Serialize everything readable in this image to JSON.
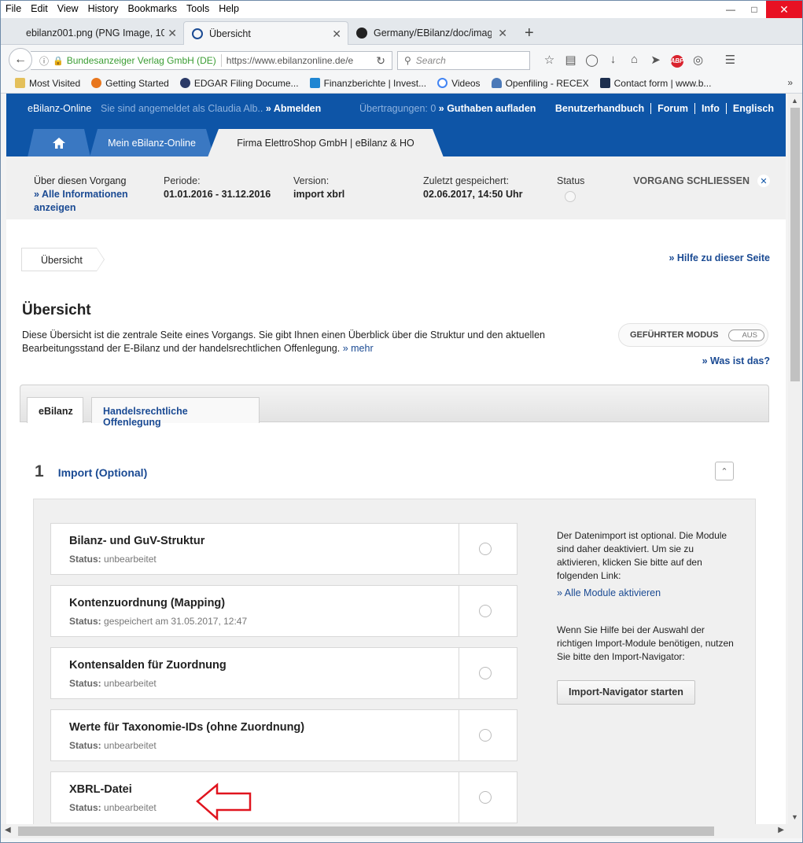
{
  "browser": {
    "menu": [
      "File",
      "Edit",
      "View",
      "History",
      "Bookmarks",
      "Tools",
      "Help"
    ],
    "tabs": [
      {
        "label": "ebilanz001.png (PNG Image, 101"
      },
      {
        "label": "Übersicht"
      },
      {
        "label": "Germany/EBilanz/doc/imag"
      }
    ],
    "url": {
      "org": "Bundesanzeiger Verlag GmbH (DE)",
      "address": "https://www.ebilanzonline.de/e"
    },
    "search_placeholder": "Search",
    "bookmarks": [
      {
        "label": "Most Visited"
      },
      {
        "label": "Getting Started"
      },
      {
        "label": "EDGAR Filing Docume..."
      },
      {
        "label": "Finanzberichte | Invest..."
      },
      {
        "label": "Videos"
      },
      {
        "label": "Openfiling - RECEX"
      },
      {
        "label": "Contact form | www.b..."
      }
    ]
  },
  "site": {
    "brand": "eBilanz-Online",
    "logged_in": "Sie sind angemeldet als Claudia Alb..",
    "logout": "» Abmelden",
    "transfers": "Übertragungen: 0",
    "topup": "» Guthaben aufladen",
    "links": [
      "Benutzerhandbuch",
      "Forum",
      "Info",
      "Englisch"
    ],
    "tabs": {
      "mein": "Mein eBilanz-Online",
      "firma": "Firma ElettroShop GmbH | eBilanz & HO"
    }
  },
  "info": {
    "about_label": "Über diesen Vorgang",
    "about_link": "» Alle Informationen anzeigen",
    "period_label": "Periode:",
    "period_value": "01.01.2016 - 31.12.2016",
    "version_label": "Version:",
    "version_value": "import xbrl",
    "saved_label": "Zuletzt gespeichert:",
    "saved_value": "02.06.2017, 14:50 Uhr",
    "status_label": "Status",
    "close_label": "VORGANG SCHLIESSEN"
  },
  "page": {
    "breadcrumb": "Übersicht",
    "help_link": "» Hilfe zu dieser Seite",
    "title": "Übersicht",
    "intro": "Diese Übersicht ist die zentrale Seite eines Vorgangs. Sie gibt Ihnen einen Überblick über die Struktur und den aktuellen Bearbeitungsstand der E-Bilanz und der handelsrechtlichen Offenlegung.",
    "intro_more": "» mehr",
    "guided_mode": "GEFÜHRTER MODUS",
    "guided_toggle": "AUS",
    "what_is": "» Was ist das?",
    "subtabs": [
      "eBilanz",
      "Handelsrechtliche Offenlegung"
    ]
  },
  "section": {
    "number": "1",
    "title": "Import (Optional)",
    "status_prefix": "Status:",
    "modules": [
      {
        "title": "Bilanz- und GuV-Struktur",
        "status": "unbearbeitet"
      },
      {
        "title": "Kontenzuordnung (Mapping)",
        "status": "gespeichert am 31.05.2017, 12:47"
      },
      {
        "title": "Kontensalden für Zuordnung",
        "status": "unbearbeitet"
      },
      {
        "title": "Werte für Taxonomie-IDs (ohne Zuordnung)",
        "status": "unbearbeitet"
      },
      {
        "title": "XBRL-Datei",
        "status": "unbearbeitet"
      }
    ],
    "side_text1": "Der Datenimport ist optional. Die Module sind daher deaktiviert. Um sie zu aktivieren, klicken Sie bitte auf den folgenden Link:",
    "side_link": "» Alle Module aktivieren",
    "side_text2": "Wenn Sie Hilfe bei der Auswahl der richtigen Import-Module benötigen, nutzen Sie bitte den Import-Navigator:",
    "side_button": "Import-Navigator starten"
  },
  "colors": {
    "brand_blue": "#0e55a7",
    "link_blue": "#1a4a93",
    "annotation_red": "#e0141e"
  }
}
